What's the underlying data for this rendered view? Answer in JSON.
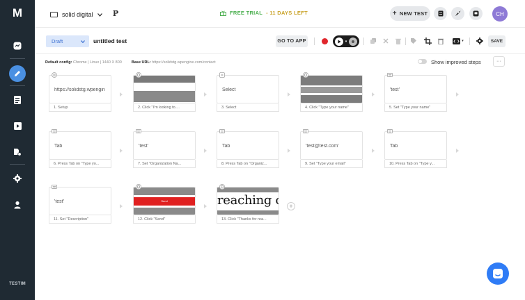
{
  "sidebar": {
    "logo": "M",
    "brand": "TESTIM",
    "icons": [
      "dashboard-icon",
      "editor-icon",
      "list-icon",
      "run-icon",
      "files-icon",
      "settings-icon",
      "user-icon"
    ]
  },
  "header": {
    "workspace": "solid digital",
    "trial_prefix": "FREE TRIAL",
    "trial_days": "- 11 DAYS LEFT",
    "new_test": "NEW TEST",
    "avatar": "CH"
  },
  "toolbar": {
    "status": "Draft",
    "test_name": "untitled test",
    "goto_app": "GO TO APP",
    "save": "SAVE"
  },
  "config": {
    "default_label": "Default config:",
    "default_value": "Chrome | Linux | 1440 X 800",
    "base_label": "Base URL:",
    "base_value": "https://solidstg.wpengine.com/contact",
    "toggle_label": "Show improved steps",
    "more": "···"
  },
  "steps": [
    {
      "type": "url",
      "text": "https://solidstg.wpengin",
      "label": "1. Setup"
    },
    {
      "type": "click",
      "text": "",
      "label": "2. Click \"I'm looking to...."
    },
    {
      "type": "select",
      "text": "Select",
      "label": "3. Select"
    },
    {
      "type": "click",
      "text": "",
      "label": "4. Click \"Type your name\""
    },
    {
      "type": "keyboard",
      "text": "'test'",
      "label": "5. Set \"Type your name\""
    },
    {
      "type": "keyboard",
      "text": "Tab",
      "label": "6. Press Tab on \"Type yo..."
    },
    {
      "type": "keyboard",
      "text": "'test'",
      "label": "7. Set \"Organization Na..."
    },
    {
      "type": "keyboard",
      "text": "Tab",
      "label": "8. Press Tab on \"Organiz..."
    },
    {
      "type": "keyboard",
      "text": "'test@test.com'",
      "label": "9. Set \"Type your email\""
    },
    {
      "type": "keyboard",
      "text": "Tab",
      "label": "10. Press Tab on \"Type y..."
    },
    {
      "type": "keyboard",
      "text": "'test'",
      "label": "11. Set \"Description\""
    },
    {
      "type": "click",
      "text": "Send",
      "label": "12. Click \"Send\""
    },
    {
      "type": "click",
      "text": "reaching ou",
      "label": "13. Click \"Thanks for rea..."
    }
  ],
  "colors": {
    "sidebar": "#1f2a33",
    "accent": "#4a90e2",
    "record": "#e0262c",
    "send": "#e02020",
    "chat": "#2f7cf6"
  }
}
